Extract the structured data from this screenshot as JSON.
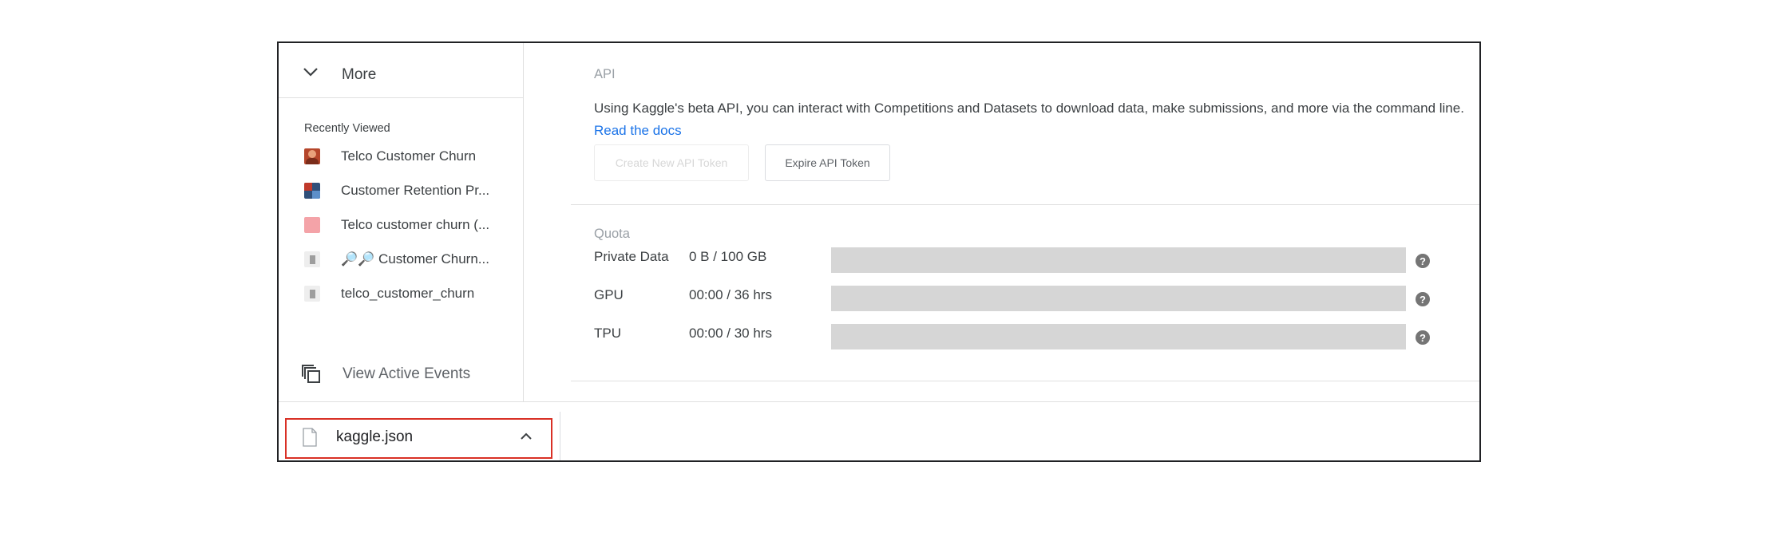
{
  "sidebar": {
    "more_label": "More",
    "recently_viewed_title": "Recently Viewed",
    "recent_items": [
      {
        "label": "Telco Customer Churn"
      },
      {
        "label": "Customer Retention Pr..."
      },
      {
        "label": "Telco customer churn (..."
      },
      {
        "label": "🔎🔎 Customer Churn..."
      },
      {
        "label": "telco_customer_churn"
      }
    ],
    "view_events_label": "View Active Events"
  },
  "api": {
    "title": "API",
    "description": "Using Kaggle's beta API, you can interact with Competitions and Datasets to download data, make submissions, and more via the command line.",
    "docs_link": "Read the docs",
    "create_token_label": "Create New API Token",
    "expire_token_label": "Expire API Token"
  },
  "quota": {
    "title": "Quota",
    "rows": [
      {
        "label": "Private Data",
        "value": "0 B / 100 GB",
        "fraction_used": 0
      },
      {
        "label": "GPU",
        "value": "00:00 / 36 hrs",
        "fraction_used": 0
      },
      {
        "label": "TPU",
        "value": "00:00 / 30 hrs",
        "fraction_used": 0
      }
    ]
  },
  "downloads": {
    "file_name": "kaggle.json"
  },
  "colors": {
    "link": "#1a73e8",
    "highlight_border": "#d93025",
    "quota_bar": "#d6d6d6"
  }
}
